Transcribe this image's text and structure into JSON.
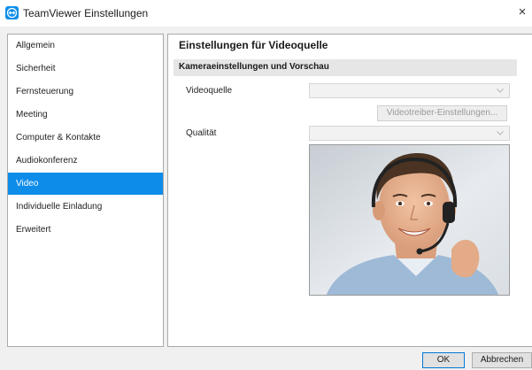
{
  "window": {
    "title": "TeamViewer Einstellungen",
    "close_glyph": "×",
    "app_icon": "teamviewer-logo-icon",
    "accent_color": "#0d8ce9"
  },
  "sidebar": {
    "items": [
      {
        "label": "Allgemein"
      },
      {
        "label": "Sicherheit"
      },
      {
        "label": "Fernsteuerung"
      },
      {
        "label": "Meeting"
      },
      {
        "label": "Computer & Kontakte"
      },
      {
        "label": "Audiokonferenz"
      },
      {
        "label": "Video",
        "selected": true
      },
      {
        "label": "Individuelle Einladung"
      },
      {
        "label": "Erweitert"
      }
    ]
  },
  "main": {
    "heading": "Einstellungen für Videoquelle",
    "section_title": "Kameraeinstellungen und Vorschau",
    "videoquelle_label": "Videoquelle",
    "videoquelle_value": "",
    "driver_button": "Videotreiber-Einstellungen...",
    "qualitaet_label": "Qualität",
    "qualitaet_value": "",
    "preview_icon": "camera-preview-image"
  },
  "footer": {
    "ok": "OK",
    "cancel": "Abbrechen"
  }
}
